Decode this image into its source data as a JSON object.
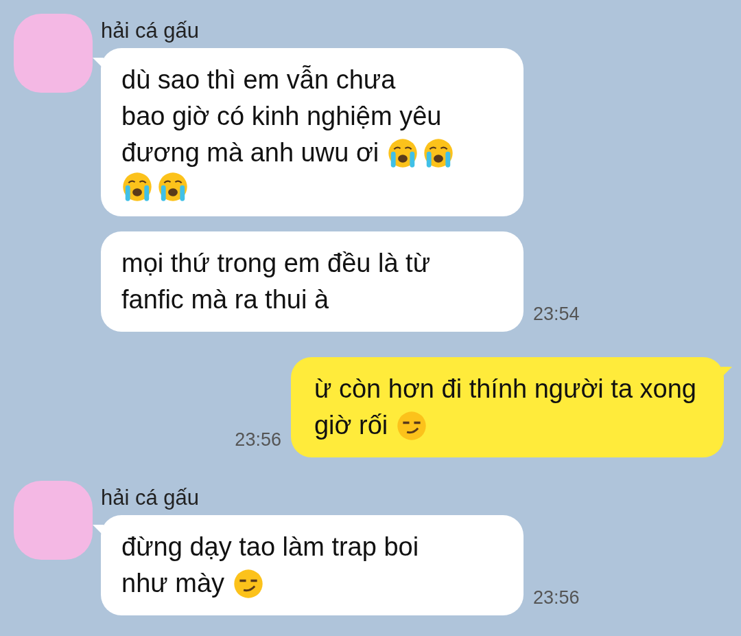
{
  "messages": [
    {
      "kind": "incoming",
      "sender": "hải cá gấu",
      "lines": [
        [
          {
            "kind": "text",
            "text": "dù sao thì em vẫn chưa"
          }
        ],
        [
          {
            "kind": "text",
            "text": "bao giờ có kinh nghiệm yêu"
          }
        ],
        [
          {
            "kind": "text",
            "text": "đương mà anh uwu ơi"
          },
          {
            "kind": "crying"
          },
          {
            "kind": "crying"
          }
        ],
        [
          {
            "kind": "crying"
          },
          {
            "kind": "crying"
          }
        ]
      ]
    },
    {
      "kind": "incoming",
      "time": "23:54",
      "lines": [
        [
          {
            "kind": "text",
            "text": "mọi thứ trong em đều là từ"
          }
        ],
        [
          {
            "kind": "text",
            "text": "fanfic mà ra thui à"
          }
        ]
      ]
    },
    {
      "kind": "outgoing",
      "time": "23:56",
      "lines": [
        [
          {
            "kind": "text",
            "text": "ừ còn hơn đi thính người ta xong"
          }
        ],
        [
          {
            "kind": "text",
            "text": "giờ rối"
          },
          {
            "kind": "smirk"
          }
        ]
      ]
    },
    {
      "kind": "incoming",
      "sender": "hải cá gấu",
      "time": "23:56",
      "lines": [
        [
          {
            "kind": "text",
            "text": "đừng dạy tao làm trap boi"
          }
        ],
        [
          {
            "kind": "text",
            "text": "như mày"
          },
          {
            "kind": "smirk"
          }
        ]
      ]
    }
  ]
}
